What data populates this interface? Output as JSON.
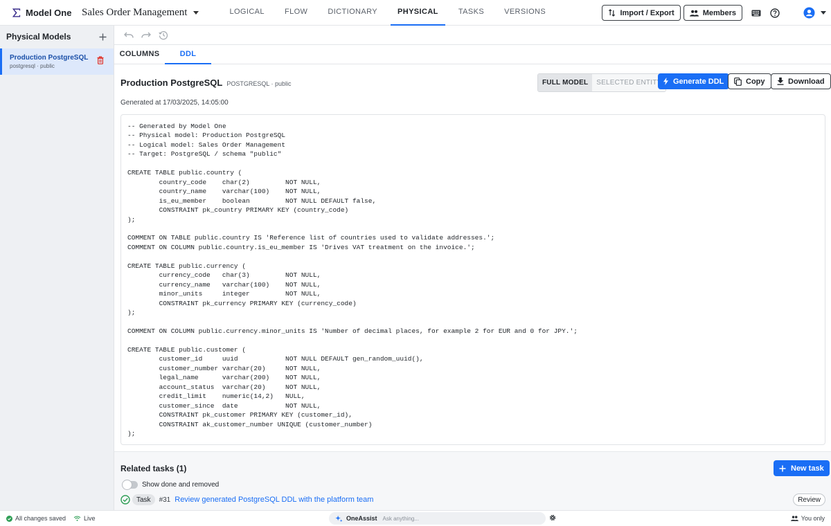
{
  "app": {
    "brand": "Model One",
    "model_title": "Sales Order Management"
  },
  "nav": {
    "tabs": [
      "LOGICAL",
      "FLOW",
      "DICTIONARY",
      "PHYSICAL",
      "TASKS",
      "VERSIONS"
    ],
    "active": "PHYSICAL"
  },
  "topbar": {
    "import_export": "Import / Export",
    "members": "Members"
  },
  "sidebar": {
    "title": "Physical Models",
    "items": [
      {
        "name": "Production PostgreSQL",
        "sub": "postgresql · public"
      }
    ]
  },
  "subtabs": {
    "items": [
      "COLUMNS",
      "DDL"
    ],
    "active": "DDL"
  },
  "ddl_header": {
    "model_name": "Production PostgreSQL",
    "model_meta": "POSTGRESQL · public",
    "scope_full": "FULL MODEL",
    "scope_selected": "SELECTED ENTITY",
    "generate": "Generate DDL",
    "copy": "Copy",
    "download": "Download",
    "generated_at": "Generated at 17/03/2025, 14:05:00"
  },
  "ddl_code": "-- Generated by Model One\n-- Physical model: Production PostgreSQL\n-- Logical model: Sales Order Management\n-- Target: PostgreSQL / schema \"public\"\n\nCREATE TABLE public.country (\n        country_code    char(2)         NOT NULL,\n        country_name    varchar(100)    NOT NULL,\n        is_eu_member    boolean         NOT NULL DEFAULT false,\n        CONSTRAINT pk_country PRIMARY KEY (country_code)\n);\n\nCOMMENT ON TABLE public.country IS 'Reference list of countries used to validate addresses.';\nCOMMENT ON COLUMN public.country.is_eu_member IS 'Drives VAT treatment on the invoice.';\n\nCREATE TABLE public.currency (\n        currency_code   char(3)         NOT NULL,\n        currency_name   varchar(100)    NOT NULL,\n        minor_units     integer         NOT NULL,\n        CONSTRAINT pk_currency PRIMARY KEY (currency_code)\n);\n\nCOMMENT ON COLUMN public.currency.minor_units IS 'Number of decimal places, for example 2 for EUR and 0 for JPY.';\n\nCREATE TABLE public.customer (\n        customer_id     uuid            NOT NULL DEFAULT gen_random_uuid(),\n        customer_number varchar(20)     NOT NULL,\n        legal_name      varchar(200)    NOT NULL,\n        account_status  varchar(20)     NOT NULL,\n        credit_limit    numeric(14,2)   NULL,\n        customer_since  date            NOT NULL,\n        CONSTRAINT pk_customer PRIMARY KEY (customer_id),\n        CONSTRAINT ak_customer_number UNIQUE (customer_number)\n);",
  "related": {
    "title": "Related tasks (1)",
    "new_task": "New task",
    "show_done": "Show done and removed",
    "tasks": [
      {
        "badge": "Task",
        "number": "#31",
        "title": "Review generated PostgreSQL DDL with the platform team",
        "action": "Review"
      }
    ]
  },
  "status": {
    "saved": "All changes saved",
    "live": "Live",
    "assist_name": "OneAssist",
    "assist_placeholder": "Ask anything...",
    "you_only": "You only"
  },
  "colors": {
    "accent": "#1a6ef5",
    "brand": "#3b2e8c",
    "danger": "#e0342b",
    "success": "#2e9e55"
  }
}
